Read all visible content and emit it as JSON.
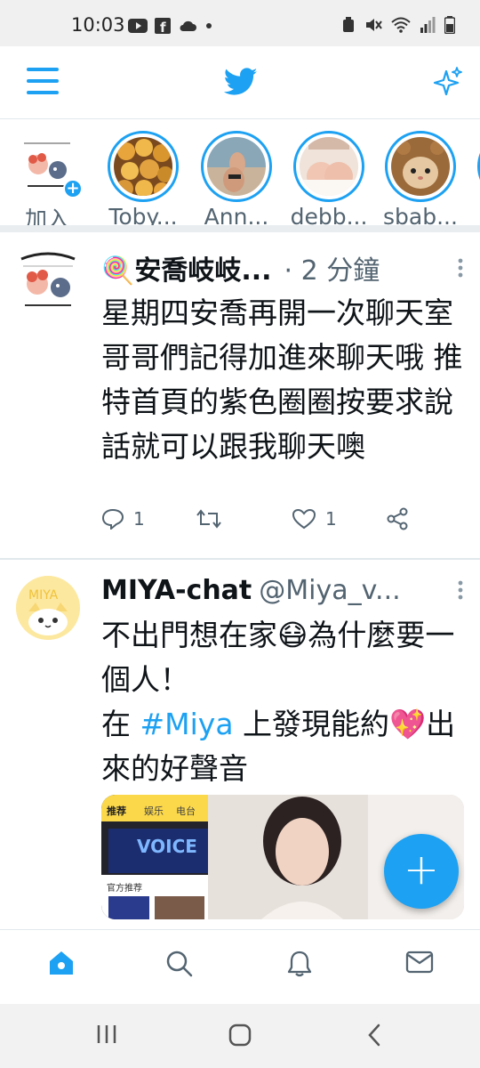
{
  "status_bar": {
    "time": "10:03"
  },
  "app": {
    "name": "Twitter",
    "accent_color": "#1da1f2"
  },
  "fleets": [
    {
      "label": "加入",
      "type": "own"
    },
    {
      "label": "Toby..."
    },
    {
      "label": "Ann..."
    },
    {
      "label": "debb..."
    },
    {
      "label": "sbab..."
    }
  ],
  "tweets": [
    {
      "display_name": "🍭安喬岐岐...",
      "meta": "· 2 分鐘",
      "text": "星期四安喬再開一次聊天室 哥哥們記得加進來聊天哦 推特首頁的紫色圈圈按要求說話就可以跟我聊天噢",
      "reply_count": "1",
      "like_count": "1"
    },
    {
      "display_name": "MIYA-chat",
      "handle": "@Miya_v...",
      "avatar_text": "MIYA",
      "text_line1": "不出門想在家😷為什麼要一個人！",
      "text_prefix": "在 ",
      "hashtag": "#Miya",
      "text_suffix": " 上發現能約💖出來的好聲音",
      "media_tabs": [
        "推荐",
        "娱乐",
        "电台"
      ],
      "media_banner": "VOICE",
      "media_sub": "官方推荐"
    }
  ],
  "fab": {
    "label": "+"
  },
  "bottom_nav": [
    "home-icon",
    "search-icon",
    "bell-icon",
    "mail-icon"
  ],
  "android_nav": [
    "recents",
    "home",
    "back"
  ]
}
